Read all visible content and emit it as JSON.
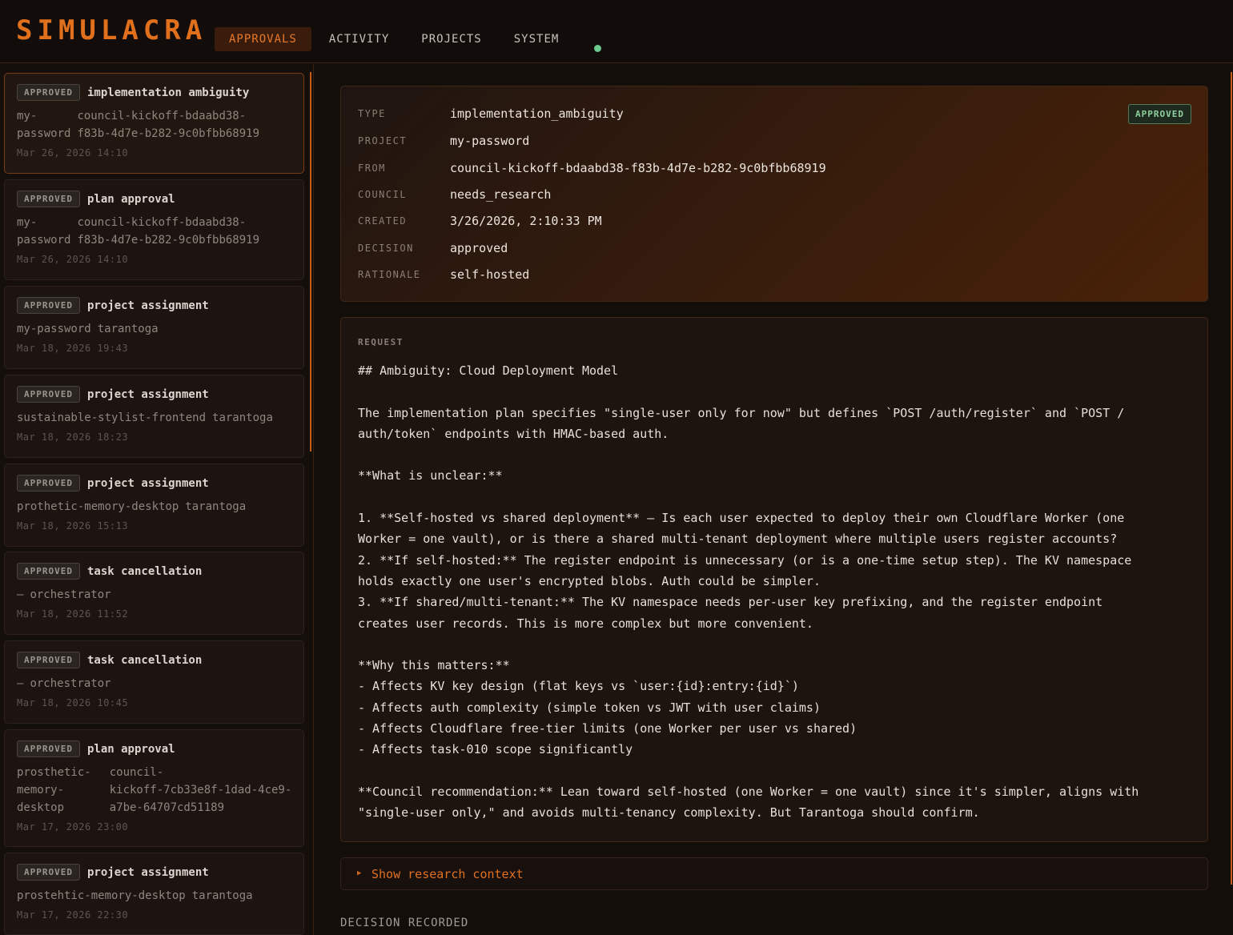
{
  "app": {
    "name": "SIMULACRA"
  },
  "nav": {
    "tabs": [
      {
        "label": "APPROVALS"
      },
      {
        "label": "ACTIVITY"
      },
      {
        "label": "PROJECTS"
      },
      {
        "label": "SYSTEM"
      }
    ],
    "status_color": "#6dca8e"
  },
  "sidebar": {
    "items": [
      {
        "badge": "APPROVED",
        "title": "implementation ambiguity",
        "project": "my-\npassword",
        "source": "council-kickoff-bdaabd38-\nf83b-4d7e-b282-9c0bfbb68919",
        "date": "Mar 26, 2026 14:10"
      },
      {
        "badge": "APPROVED",
        "title": "plan approval",
        "project": "my-\npassword",
        "source": "council-kickoff-bdaabd38-\nf83b-4d7e-b282-9c0bfbb68919",
        "date": "Mar 26, 2026 14:10"
      },
      {
        "badge": "APPROVED",
        "title": "project assignment",
        "project": "my-password",
        "source": "tarantoga",
        "date": "Mar 18, 2026 19:43"
      },
      {
        "badge": "APPROVED",
        "title": "project assignment",
        "project": "sustainable-stylist-frontend",
        "source": "tarantoga",
        "date": "Mar 18, 2026 18:23"
      },
      {
        "badge": "APPROVED",
        "title": "project assignment",
        "project": "prothetic-memory-desktop",
        "source": "tarantoga",
        "date": "Mar 18, 2026 15:13"
      },
      {
        "badge": "APPROVED",
        "title": "task cancellation",
        "project": "—",
        "source": "orchestrator",
        "date": "Mar 18, 2026 11:52"
      },
      {
        "badge": "APPROVED",
        "title": "task cancellation",
        "project": "—",
        "source": "orchestrator",
        "date": "Mar 18, 2026 10:45"
      },
      {
        "badge": "APPROVED",
        "title": "plan approval",
        "project": "prosthetic-\nmemory-\ndesktop",
        "source": "council-\nkickoff-7cb33e8f-1dad-4ce9-\na7be-64707cd51189",
        "date": "Mar 17, 2026 23:00"
      },
      {
        "badge": "APPROVED",
        "title": "project assignment",
        "project": "prostehtic-memory-desktop",
        "source": "tarantoga",
        "date": "Mar 17, 2026 22:30"
      }
    ]
  },
  "detail": {
    "status": "APPROVED",
    "fields": [
      {
        "label": "TYPE",
        "value": "implementation_ambiguity"
      },
      {
        "label": "PROJECT",
        "value": "my-password"
      },
      {
        "label": "FROM",
        "value": "council-kickoff-bdaabd38-f83b-4d7e-b282-9c0bfbb68919"
      },
      {
        "label": "COUNCIL",
        "value": "needs_research"
      },
      {
        "label": "CREATED",
        "value": "3/26/2026, 2:10:33 PM"
      },
      {
        "label": "DECISION",
        "value": "approved"
      },
      {
        "label": "RATIONALE",
        "value": "self-hosted"
      }
    ],
    "request_label": "REQUEST",
    "request_body": "## Ambiguity: Cloud Deployment Model\n\nThe implementation plan specifies \"single-user only for now\" but defines `POST /auth/register` and `POST /\nauth/token` endpoints with HMAC-based auth.\n\n**What is unclear:**\n\n1. **Self-hosted vs shared deployment** — Is each user expected to deploy their own Cloudflare Worker (one\nWorker = one vault), or is there a shared multi-tenant deployment where multiple users register accounts?\n2. **If self-hosted:** The register endpoint is unnecessary (or is a one-time setup step). The KV namespace\nholds exactly one user's encrypted blobs. Auth could be simpler.\n3. **If shared/multi-tenant:** The KV namespace needs per-user key prefixing, and the register endpoint\ncreates user records. This is more complex but more convenient.\n\n**Why this matters:**\n- Affects KV key design (flat keys vs `user:{id}:entry:{id}`)\n- Affects auth complexity (simple token vs JWT with user claims)\n- Affects Cloudflare free-tier limits (one Worker per user vs shared)\n- Affects task-010 scope significantly\n\n**Council recommendation:** Lean toward self-hosted (one Worker = one vault) since it's simpler, aligns with\n\"single-user only,\" and avoids multi-tenancy complexity. But Tarantoga should confirm.",
    "research_toggle": "Show research context",
    "decision_heading": "DECISION RECORDED"
  }
}
